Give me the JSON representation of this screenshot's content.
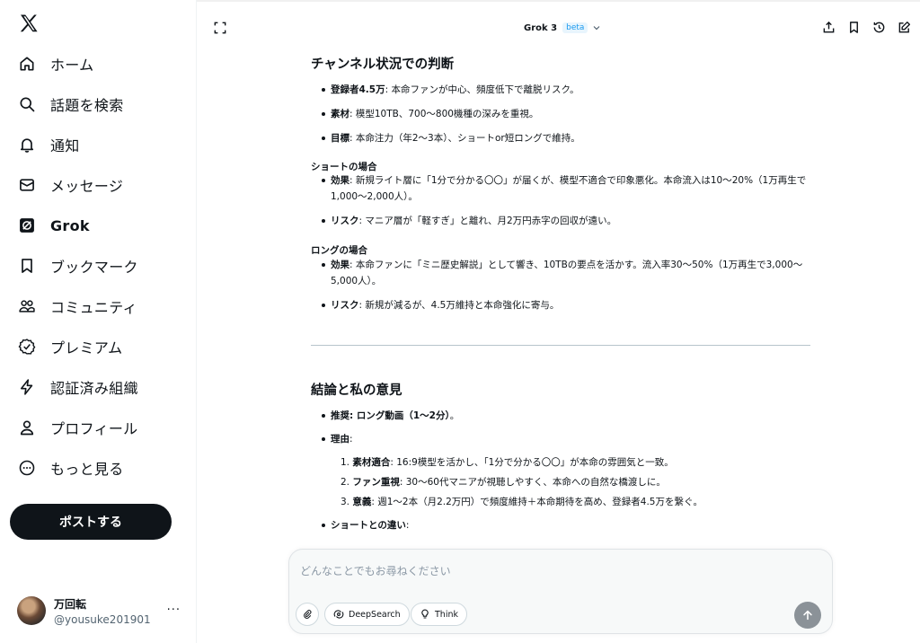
{
  "sidebar": {
    "items": [
      {
        "label": "ホーム",
        "icon": "home-icon"
      },
      {
        "label": "話題を検索",
        "icon": "search-icon"
      },
      {
        "label": "通知",
        "icon": "bell-icon"
      },
      {
        "label": "メッセージ",
        "icon": "mail-icon"
      },
      {
        "label": "Grok",
        "icon": "grok-icon"
      },
      {
        "label": "ブックマーク",
        "icon": "bookmark-icon"
      },
      {
        "label": "コミュニティ",
        "icon": "community-icon"
      },
      {
        "label": "プレミアム",
        "icon": "premium-icon"
      },
      {
        "label": "認証済み組織",
        "icon": "lightning-icon"
      },
      {
        "label": "プロフィール",
        "icon": "person-icon"
      },
      {
        "label": "もっと見る",
        "icon": "more-circle-icon"
      }
    ],
    "post_label": "ポストする",
    "account": {
      "name": "万回転",
      "handle": "@yousuke201901",
      "more": "···"
    }
  },
  "header": {
    "model": "Grok 3",
    "badge": "beta"
  },
  "content": {
    "section1_title": "チャンネル状況での判断",
    "s1_b1_key": "登録者4.5万",
    "s1_b1_text": ": 本命ファンが中心、頻度低下で離脱リスク。",
    "s1_b2_key": "素材",
    "s1_b2_text": ": 模型10TB、700〜800機種の深みを重視。",
    "s1_b3_key": "目標",
    "s1_b3_text": ": 本命注力（年2〜3本）、ショートor短ロングで維持。",
    "short_title": "ショートの場合",
    "sh_b1_key": "効果",
    "sh_b1_text": ": 新規ライト層に「1分で分かる〇〇」が届くが、模型不適合で印象悪化。本命流入は10〜20%（1万再生で1,000〜2,000人）。",
    "sh_b2_key": "リスク",
    "sh_b2_text": ": マニア層が「軽すぎ」と離れ、月2万円赤字の回収が遠い。",
    "long_title": "ロングの場合",
    "lg_b1_key": "効果",
    "lg_b1_text": ": 本命ファンに「ミニ歴史解説」として響き、10TBの要点を活かす。流入率30〜50%（1万再生で3,000〜5,000人）。",
    "lg_b2_key": "リスク",
    "lg_b2_text": ": 新規が減るが、4.5万維持と本命強化に寄与。",
    "section2_title": "結論と私の意見",
    "c_b1_key": "推奨: ロング動画（1〜2分）",
    "c_b1_text": "。",
    "c_b2_key": "理由",
    "c_b2_text": ":",
    "r1_key": "素材適合",
    "r1_text": ": 16:9模型を活かし、「1分で分かる〇〇」が本命の雰囲気と一致。",
    "r2_key": "ファン重視",
    "r2_text": ": 30〜60代マニアが視聴しやすく、本命への自然な橋渡しに。",
    "r3_key": "意義",
    "r3_text": ": 週1〜2本（月2.2万円）で頻度維持＋本命期待を高め、登録者4.5万を繋ぐ。",
    "c_b3_key": "ショートとの違い",
    "c_b3_text": ":"
  },
  "composer": {
    "placeholder": "どんなことでもお尋ねください",
    "deepsearch": "DeepSearch",
    "think": "Think"
  }
}
